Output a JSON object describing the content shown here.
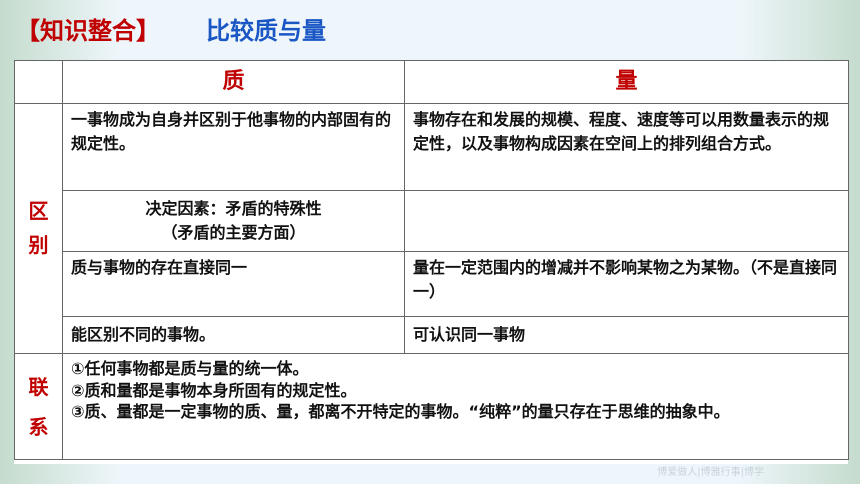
{
  "title": {
    "bracket_label": "【知识整合】",
    "main": "比较质与量"
  },
  "table": {
    "headers": [
      "",
      "质",
      "量"
    ],
    "side_labels": {
      "difference": "区别",
      "connection": "联系"
    },
    "rows": [
      {
        "quality": "一事物成为自身并区别于他事物的内部固有的规定性。",
        "quantity": "事物存在和发展的规模、程度、速度等可以用数量表示的规定性，以及事物构成因素在空间上的排列组合方式。"
      },
      {
        "quality_line1": "决定因素：矛盾的特殊性",
        "quality_line2": "（矛盾的主要方面）",
        "quantity": ""
      },
      {
        "quality": "质与事物的存在直接同一",
        "quantity": "量在一定范围内的增减并不影响某物之为某物。（不是直接同一）"
      },
      {
        "quality": "能区别不同的事物。",
        "quantity": "可认识同一事物"
      }
    ],
    "connection_lines": [
      "①任何事物都是质与量的统一体。",
      "②质和量都是事物本身所固有的规定性。",
      "③质、量都是一定事物的质、量，都离不开特定的事物。“纯粹”的量只存在于思维的抽象中。"
    ]
  },
  "watermark": "博爱做人|博雅行事|博学"
}
